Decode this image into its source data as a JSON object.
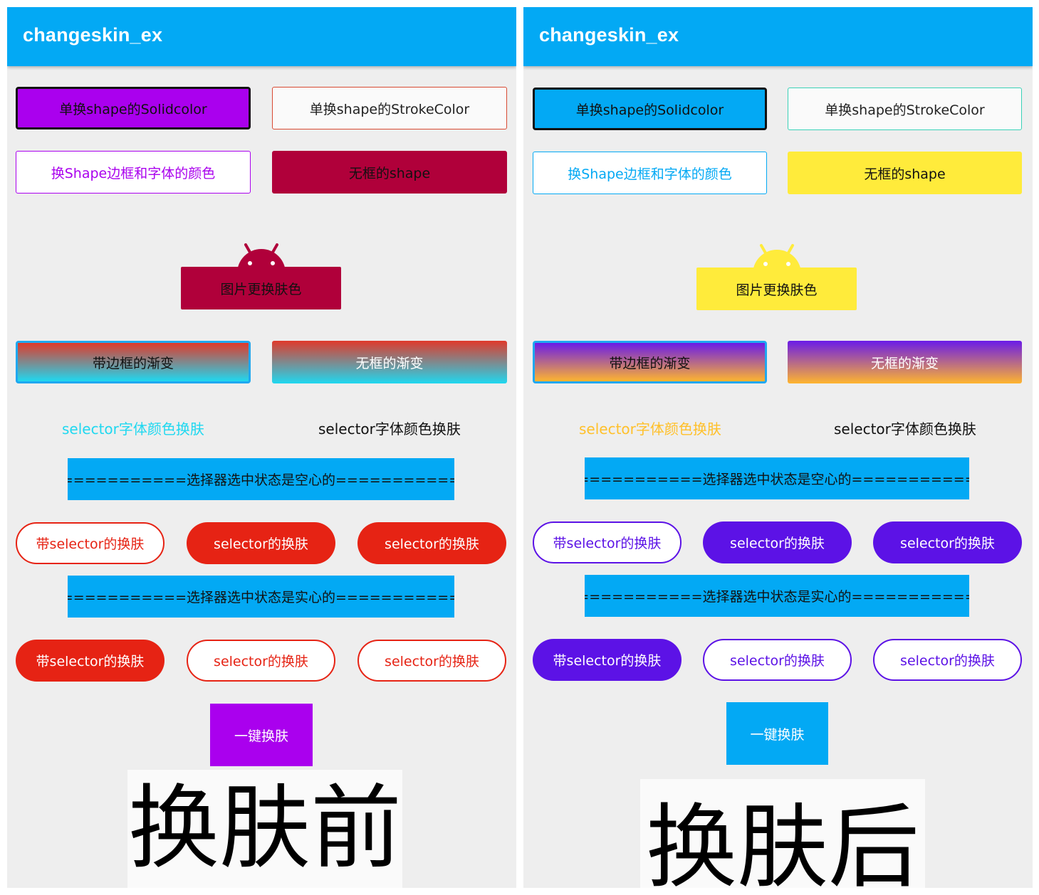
{
  "left": {
    "app_title": "changeskin_ex",
    "btn_solidcolor": "单换shape的Solidcolor",
    "btn_strokecolor": "单换shape的StrokeColor",
    "btn_border_font": "换Shape边框和字体的颜色",
    "btn_noborder": "无框的shape",
    "btn_image": "图片更换肤色",
    "btn_gradient_border": "带边框的渐变",
    "btn_gradient_noborder": "无框的渐变",
    "selector_text_1": "selector字体颜色换肤",
    "selector_text_2": "selector字体颜色换肤",
    "divider_hollow": "=============选择器选中状态是空心的=============",
    "pill_row1": [
      "带selector的换肤",
      "selector的换肤",
      "selector的换肤"
    ],
    "divider_solid": "=============选择器选中状态是实心的=============",
    "pill_row2": [
      "带selector的换肤",
      "selector的换肤",
      "selector的换肤"
    ],
    "one_key": "一键换肤",
    "caption": "换肤前",
    "colors": {
      "accent": "#aa00ee",
      "shape": "#b0003a",
      "pill": "#e62314",
      "gradient_top": "#e03a2b",
      "gradient_bottom": "#1fd8f0"
    }
  },
  "right": {
    "app_title": "changeskin_ex",
    "btn_solidcolor": "单换shape的Solidcolor",
    "btn_strokecolor": "单换shape的StrokeColor",
    "btn_border_font": "换Shape边框和字体的颜色",
    "btn_noborder": "无框的shape",
    "btn_image": "图片更换肤色",
    "btn_gradient_border": "带边框的渐变",
    "btn_gradient_noborder": "无框的渐变",
    "selector_text_1": "selector字体颜色换肤",
    "selector_text_2": "selector字体颜色换肤",
    "divider_hollow": "=============选择器选中状态是空心的=============",
    "pill_row1": [
      "带selector的换肤",
      "selector的换肤",
      "selector的换肤"
    ],
    "divider_solid": "=============选择器选中状态是实心的=============",
    "pill_row2": [
      "带selector的换肤",
      "selector的换肤",
      "selector的换肤"
    ],
    "one_key": "一键换肤",
    "caption": "换肤后",
    "colors": {
      "accent": "#03a9f4",
      "shape": "#ffeb3b",
      "pill": "#5c12e6",
      "gradient_top": "#6a1be8",
      "gradient_bottom": "#ffb52e"
    }
  }
}
